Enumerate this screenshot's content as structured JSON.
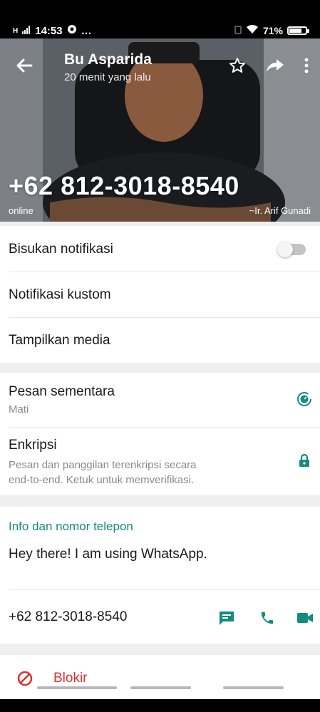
{
  "status": {
    "time": "14:53",
    "signal": "H",
    "dots": "…",
    "battery": "71%",
    "battery_level": 0.71
  },
  "header": {
    "contact_name": "Bu Asparida",
    "last_seen": "20 menit yang lalu",
    "phone": "+62 812-3018-8540",
    "presence": "online",
    "push_name": "~Ir. Arif Gunadi"
  },
  "settings": {
    "mute": "Bisukan notifikasi",
    "mute_on": false,
    "custom_notif": "Notifikasi kustom",
    "media": "Tampilkan media"
  },
  "privacy": {
    "disappearing_title": "Pesan sementara",
    "disappearing_value": "Mati",
    "encryption_title": "Enkripsi",
    "encryption_line1": "Pesan dan panggilan terenkripsi secara",
    "encryption_line2": "end-to-end. Ketuk untuk memverifikasi."
  },
  "about": {
    "section_title": "Info dan nomor telepon",
    "about_text": "Hey there! I am using WhatsApp.",
    "phone": "+62 812-3018-8540"
  },
  "actions": {
    "block_label": "Blokir"
  },
  "colors": {
    "accent": "#128c7e",
    "danger": "#d9312b"
  }
}
